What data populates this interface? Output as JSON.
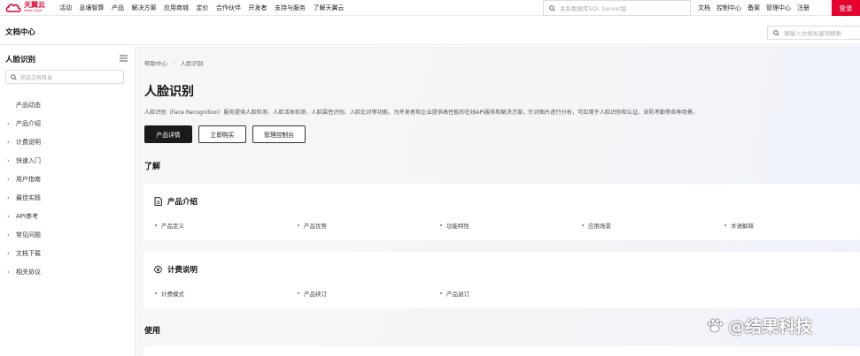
{
  "brand": {
    "name_cn": "天翼云",
    "name_en": "State Cloud",
    "color": "#e6002d"
  },
  "topnav": {
    "items": [
      "活动",
      "息壤智算",
      "产品",
      "解决方案",
      "应用商城",
      "定价",
      "合作伙伴",
      "开发者",
      "支持与服务",
      "了解天翼云"
    ],
    "search_placeholder": "关系数据库SQL Server版",
    "right_links": [
      "文档",
      "控制中心",
      "备案",
      "管理中心",
      "注册"
    ],
    "login": "登录"
  },
  "docbar": {
    "title": "文档中心",
    "search_placeholder": "请输入文档关键词搜索"
  },
  "sidebar": {
    "title": "人脸识别",
    "search_placeholder": "筛选文档目录",
    "items": [
      {
        "label": "产品动态",
        "expandable": false
      },
      {
        "label": "产品介绍",
        "expandable": true
      },
      {
        "label": "计费说明",
        "expandable": true
      },
      {
        "label": "快速入门",
        "expandable": true
      },
      {
        "label": "用户指南",
        "expandable": true
      },
      {
        "label": "最佳实践",
        "expandable": true
      },
      {
        "label": "API参考",
        "expandable": true
      },
      {
        "label": "常见问题",
        "expandable": true
      },
      {
        "label": "文档下载",
        "expandable": true
      },
      {
        "label": "相关协议",
        "expandable": true
      }
    ]
  },
  "main": {
    "breadcrumb": [
      "帮助中心",
      "人脸识别"
    ],
    "title": "人脸识别",
    "description": "人脸识别（Face Recognition）服务提供人脸检测、人脸活体检测、人脸属性识别、人脸比对等功能。为开发者和企业提供高性能的在线API服务和解决方案，针对图片进行分析，可应用于人脸识别和认证、安防考勤等各种场景。",
    "buttons": {
      "detail": "产品详情",
      "buy": "立即购买",
      "console": "管理控制台"
    },
    "section_learn": "了解",
    "section_use": "使用",
    "cards": [
      {
        "title": "产品介绍",
        "icon": "document-icon",
        "links": [
          "产品定义",
          "产品优势",
          "功能特性",
          "应用场景",
          "术语解释"
        ]
      },
      {
        "title": "计费说明",
        "icon": "yuan-icon",
        "links": [
          "计费模式",
          "产品续订",
          "产品退订"
        ]
      }
    ]
  },
  "watermark": {
    "text": "@结果科技"
  }
}
